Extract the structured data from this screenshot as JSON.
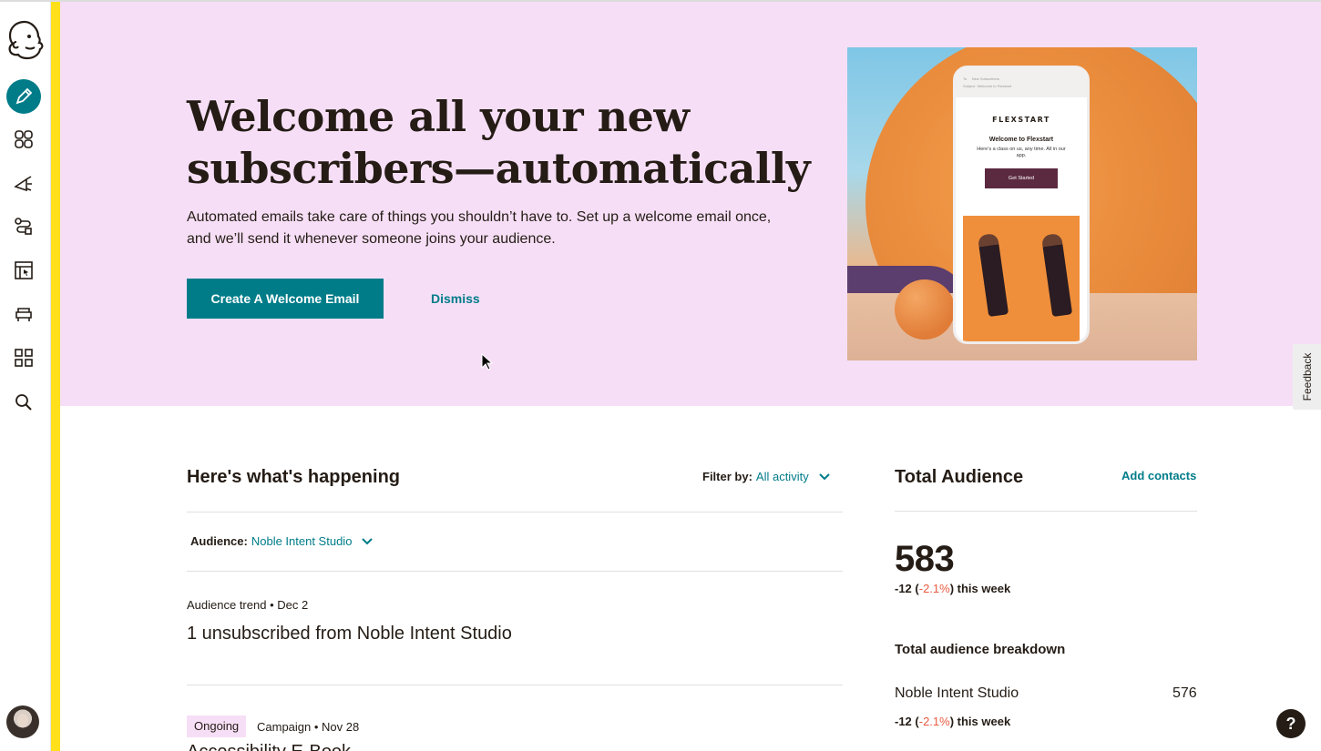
{
  "hero": {
    "title": "Welcome all your new subscribers—automatically",
    "description": "Automated emails take care of things you shouldn’t have to. Set up a welcome email once, and we’ll send it whenever someone joins your audience.",
    "primary_button": "Create A Welcome Email",
    "dismiss_button": "Dismiss",
    "phone": {
      "to_label": "To",
      "to_value": "New Subscribers",
      "subject_label": "Subject",
      "subject_value": "Welcome to Flexstart",
      "brand": "FLEXSTART",
      "heading": "Welcome to Flexstart",
      "body": "Here’s a class on us, any time. All in our app.",
      "button": "Get Started"
    }
  },
  "feedback_label": "Feedback",
  "activity": {
    "title": "Here's what's happening",
    "filter_label": "Filter by:",
    "filter_value": "All activity",
    "audience_label": "Audience:",
    "audience_value": "Noble Intent Studio",
    "items": [
      {
        "meta": "Audience trend  • Dec 2",
        "text": "1 unsubscribed from Noble Intent Studio"
      },
      {
        "badge": "Ongoing",
        "meta": "Campaign  • Nov 28",
        "text": "Accessibility E-Book"
      }
    ]
  },
  "audience": {
    "title": "Total Audience",
    "add_link": "Add contacts",
    "total": "583",
    "change_prefix": "-12 (",
    "change_pct": "-2.1%",
    "change_suffix": ") this week",
    "breakdown_title": "Total audience breakdown",
    "breakdown": [
      {
        "name": "Noble Intent Studio",
        "count": "576",
        "change_prefix": "-12 (",
        "change_pct": "-2.1%",
        "change_suffix": ") this week"
      }
    ]
  },
  "help_label": "?",
  "colors": {
    "accent": "#007c89",
    "hero_bg": "#f6dff6",
    "brand_yellow": "#ffe01b",
    "negative": "#e85c41"
  }
}
